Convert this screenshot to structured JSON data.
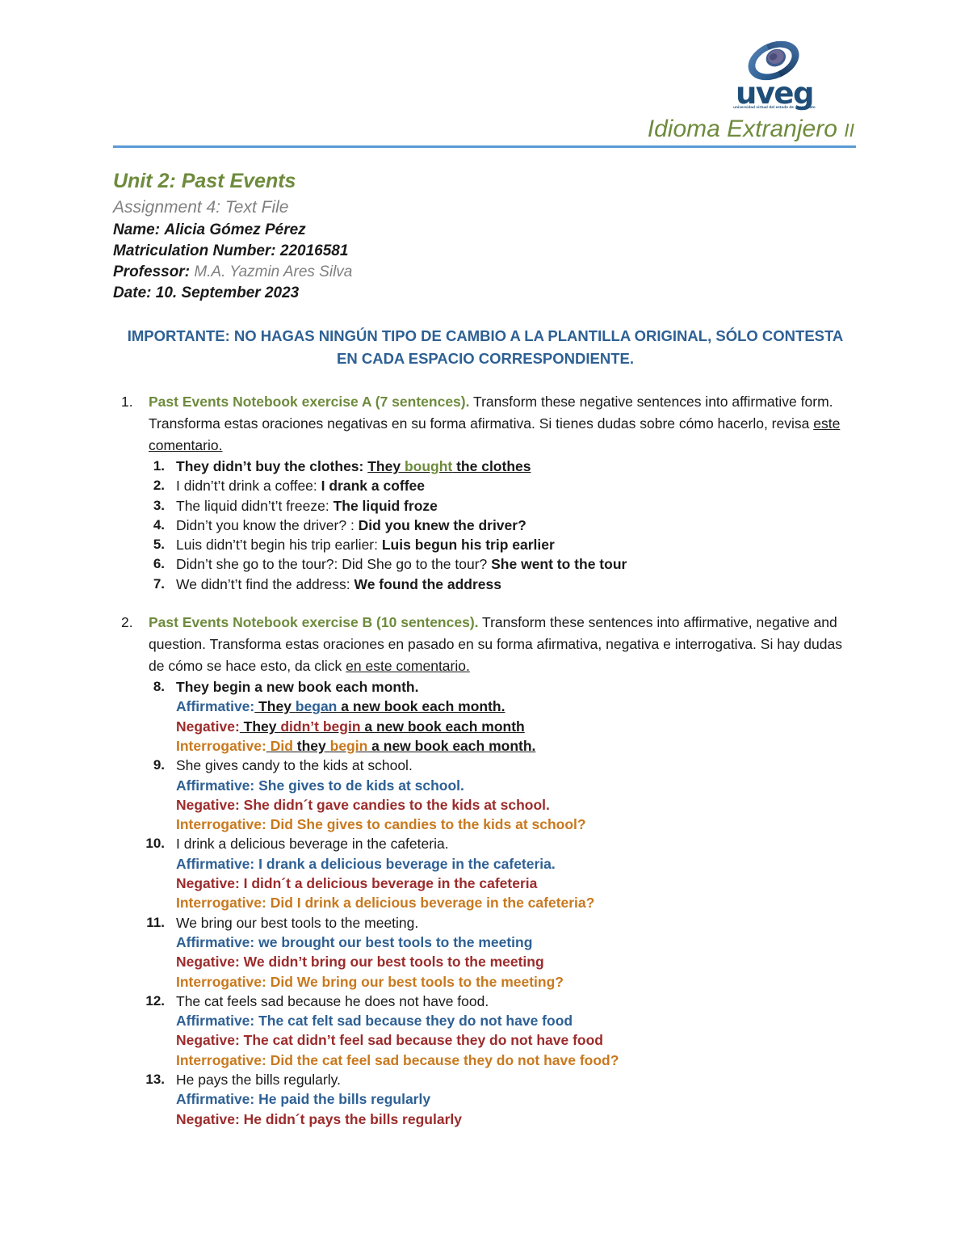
{
  "header": {
    "logo": {
      "wordmark": "uveg",
      "tagline": "universidad virtual del estado de guanajuato"
    },
    "course_title_main": "Idioma Extranjero",
    "course_title_suffix": "II"
  },
  "title_block": {
    "unit": "Unit 2: Past Events",
    "assignment": "Assignment 4: Text File",
    "name_label": "Name:",
    "name_value": "Alicia Gómez Pérez",
    "matriculation_label": "Matriculation Number:",
    "matriculation_value": "22016581",
    "professor_label": "Professor:",
    "professor_value": "M.A. Yazmin Ares Silva",
    "date_label": "Date:",
    "date_value": "10. September 2023"
  },
  "notice": {
    "line1": "IMPORTANTE: NO HAGAS NINGÚN TIPO DE CAMBIO A LA PLANTILLA ORIGINAL, SÓLO CONTESTA EN",
    "line2": "CADA ESPACIO CORRESPONDIENTE."
  },
  "exercise_a": {
    "number": "1.",
    "lead": "Past Events Notebook exercise A (7 sentences).",
    "instructions": " Transform these negative sentences into affirmative form. Transforma estas oraciones negativas en su forma afirmativa. Si tienes dudas sobre cómo hacerlo, revisa ",
    "link": "este comentario.",
    "items": [
      {
        "index": "1.",
        "style": "example",
        "prompt": "They didn’t buy the clothes: ",
        "answer_pre": "They ",
        "answer_verb": "bought",
        "answer_post": " the clothes"
      },
      {
        "index": "2.",
        "style": "plain",
        "prompt": "I didn’t’t drink a coffee:  ",
        "answer": "I drank a coffee"
      },
      {
        "index": "3.",
        "style": "plain",
        "prompt": "The liquid didn’t’t freeze: ",
        "answer": "The liquid froze"
      },
      {
        "index": "4.",
        "style": "plain",
        "prompt": "Didn’t you know the driver? : ",
        "answer": "Did you knew the driver?"
      },
      {
        "index": "5.",
        "style": "plain",
        "prompt": "Luis didn’t’t begin his trip earlier: ",
        "answer": "Luis begun his trip earlier"
      },
      {
        "index": "6.",
        "style": "plain",
        "prompt": "Didn’t she go to the tour?: Did She go to the tour? ",
        "answer": "She went to the tour"
      },
      {
        "index": "7.",
        "style": "plain",
        "prompt": "We didn’t’t find the address: ",
        "answer": "We found the address"
      }
    ]
  },
  "exercise_b": {
    "number": "2.",
    "lead": "Past Events Notebook exercise B (10 sentences).",
    "instructions": " Transform these sentences into affirmative, negative and question. Transforma estas oraciones en pasado en su forma afirmativa, negativa e interrogativa. Si hay dudas de cómo se hace esto, da click ",
    "link": "en este comentario.",
    "labels": {
      "affirmative": "Affirmative:",
      "negative": "Negative:",
      "interrogative": "Interrogative:"
    },
    "items": [
      {
        "index": "8.",
        "style": "example",
        "prompt": "They begin a new book each month.",
        "affirmative": {
          "pre": " They ",
          "verb": "began",
          "post": " a new book each month."
        },
        "negative": {
          "pre": " They ",
          "verb": "didn’t begin",
          "post": " a new book each month"
        },
        "interrogative": {
          "pre": " ",
          "verb": "Did",
          "mid": " they ",
          "verb2": "begin",
          "post": " a new book each month."
        }
      },
      {
        "index": "9.",
        "style": "answer",
        "prompt": "She gives candy to the kids at school.",
        "affirmative": " She gives to de kids at school.",
        "negative": " She didn´t gave candies to the kids at school.",
        "interrogative": " Did She gives to candies to the kids at school?"
      },
      {
        "index": "10.",
        "style": "answer",
        "prompt": "I drink a delicious beverage in the cafeteria.",
        "affirmative": " I drank a delicious beverage in the cafeteria.",
        "negative": " I didn´t a delicious beverage in the cafeteria",
        "interrogative": " Did I drink a delicious beverage in the cafeteria?"
      },
      {
        "index": "11.",
        "style": "answer",
        "prompt": "We bring our best tools to the meeting.",
        "affirmative": " we brought our best tools to the meeting",
        "negative": " We didn’t bring our best tools to the meeting",
        "interrogative": " Did We bring our best tools to the meeting?"
      },
      {
        "index": "12.",
        "style": "answer",
        "prompt": "The cat feels sad because he does not have food.",
        "affirmative": " The cat felt sad because they do not have food",
        "negative": " The cat didn’t feel sad because they do not have food",
        "interrogative": " Did the cat feel sad because they do not have food?"
      },
      {
        "index": "13.",
        "style": "answer",
        "prompt": "He pays the bills regularly.",
        "affirmative": " He paid the bills regularly",
        "negative": " He didn´t pays the bills regularly"
      }
    ]
  },
  "colors": {
    "green": "#6E8B3D",
    "blue_rule": "#5B9BD5",
    "notice_blue": "#2E6094",
    "affirmative": "#2E6094",
    "negative": "#9C2B2B",
    "interrogative": "#C8791E",
    "logo_blue": "#1F4E79",
    "gray": "#808080"
  }
}
